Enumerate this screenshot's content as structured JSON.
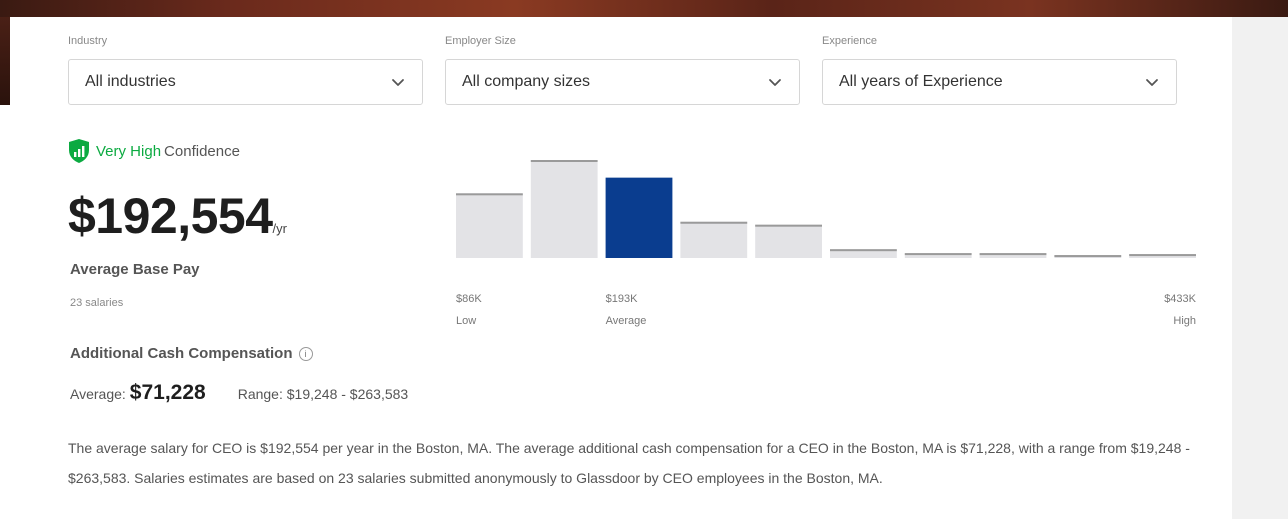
{
  "filters": [
    {
      "label": "Industry",
      "value": "All industries"
    },
    {
      "label": "Employer Size",
      "value": "All company sizes"
    },
    {
      "label": "Experience",
      "value": "All years of Experience"
    }
  ],
  "confidence": {
    "level": "Very High",
    "suffix": "Confidence",
    "color": "#0caa41"
  },
  "base_pay": {
    "amount": "$192,554",
    "period": "/yr",
    "label": "Average Base Pay",
    "count": "23 salaries"
  },
  "chart_data": {
    "type": "bar",
    "values": [
      0.66,
      1.0,
      0.82,
      0.37,
      0.34,
      0.09,
      0.05,
      0.05,
      0.03,
      0.04
    ],
    "highlight_index": 2,
    "bar_color": "#e3e3e6",
    "highlight_color": "#0a3d8f",
    "markers": [
      {
        "index": 0,
        "value": "$86K",
        "caption": "Low"
      },
      {
        "index": 2,
        "value": "$193K",
        "caption": "Average"
      },
      {
        "index": 9,
        "value": "$433K",
        "caption": "High"
      }
    ]
  },
  "additional": {
    "title": "Additional Cash Compensation",
    "info_glyph": "i",
    "average_label": "Average:",
    "average_value": "$71,228",
    "range_label": "Range:",
    "range_value": "$19,248 - $263,583"
  },
  "description": "The average salary for CEO is $192,554 per year in the Boston, MA. The average additional cash compensation for a CEO in the Boston, MA is $71,228, with a range from $19,248 - $263,583. Salaries estimates are based on 23 salaries submitted anonymously to Glassdoor by CEO employees in the Boston, MA."
}
